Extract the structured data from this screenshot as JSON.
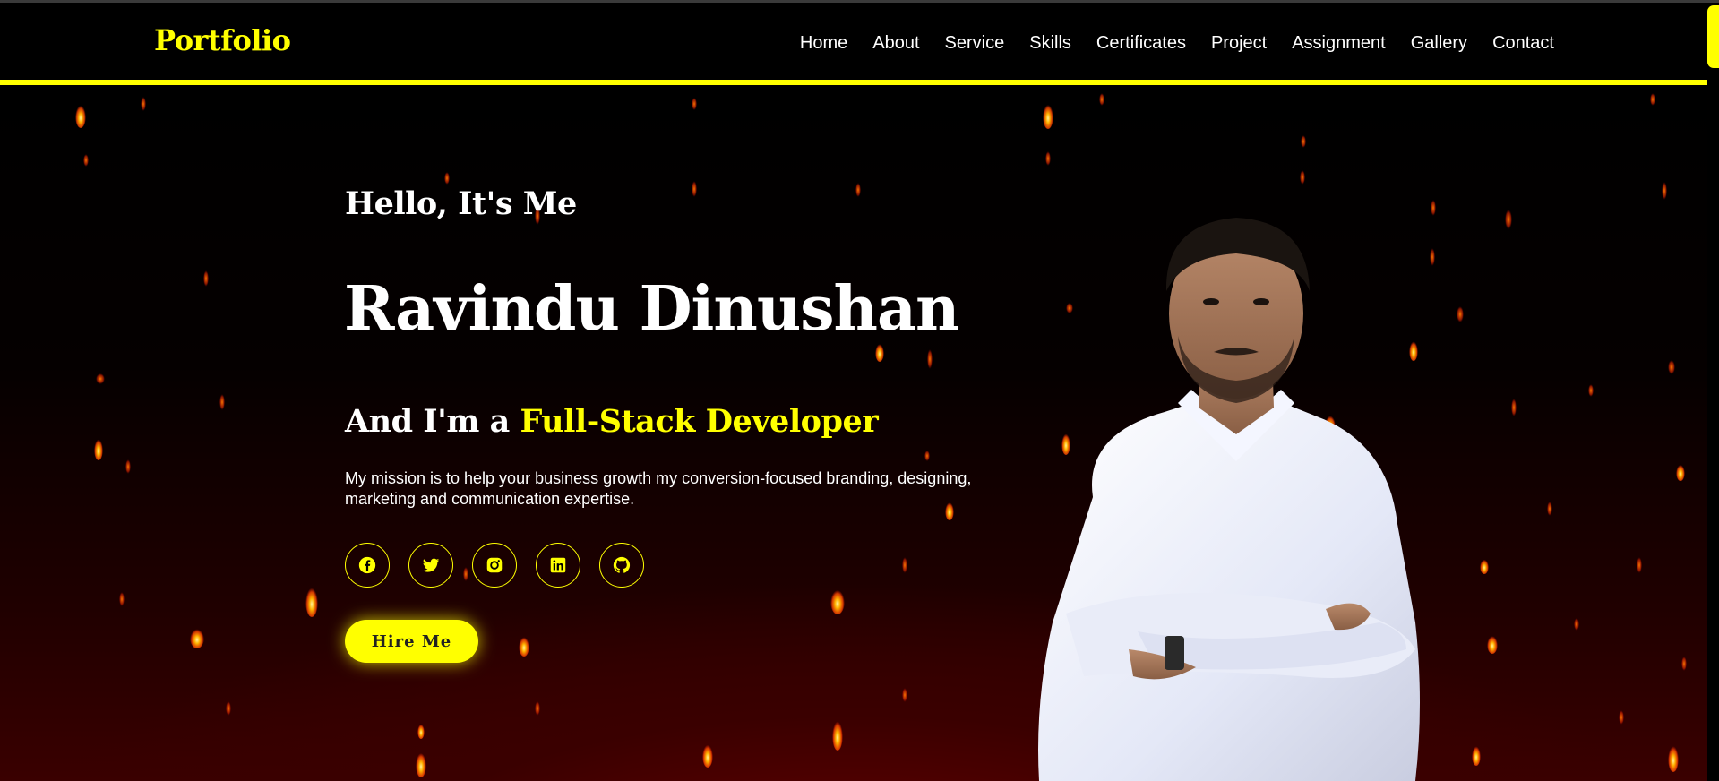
{
  "header": {
    "logo": "Portfolio",
    "nav": [
      {
        "label": "Home"
      },
      {
        "label": "About"
      },
      {
        "label": "Service"
      },
      {
        "label": "Skills"
      },
      {
        "label": "Certificates"
      },
      {
        "label": "Project"
      },
      {
        "label": "Assignment"
      },
      {
        "label": "Gallery"
      },
      {
        "label": "Contact"
      }
    ]
  },
  "hero": {
    "greeting": "Hello, It's Me",
    "name": "Ravindu Dinushan",
    "role_prefix": "And I'm a ",
    "role": "Full-Stack Developer",
    "mission": "My mission is to help your business growth my conversion-focused branding, designing, marketing and communication expertise.",
    "hire_button": "Hire Me",
    "socials": [
      {
        "icon": "facebook-icon"
      },
      {
        "icon": "twitter-icon"
      },
      {
        "icon": "instagram-icon"
      },
      {
        "icon": "linkedin-icon"
      },
      {
        "icon": "github-icon"
      }
    ]
  },
  "colors": {
    "accent": "#ffff00",
    "background": "#000000",
    "text": "#ffffff",
    "glow": "#3a0000"
  }
}
